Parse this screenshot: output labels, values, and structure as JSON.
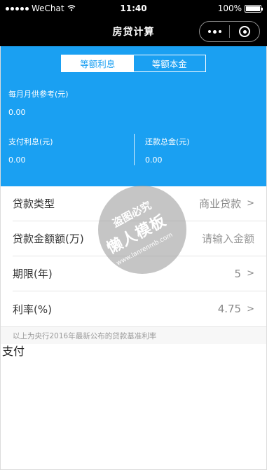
{
  "status_bar": {
    "carrier": "WeChat",
    "time": "11:40",
    "battery": "100%",
    "battery_level": 1.0
  },
  "nav": {
    "title": "房贷计算"
  },
  "tabs": [
    {
      "label": "等额利息"
    },
    {
      "label": "等额本金"
    }
  ],
  "summary": {
    "monthly_label": "每月月供参考(元)",
    "monthly_value": "0.00",
    "interest_label": "支付利息(元)",
    "interest_value": "0.00",
    "total_label": "还款总金(元)",
    "total_value": "0.00"
  },
  "form": {
    "loan_type": {
      "label": "贷款类型",
      "value": "商业贷款"
    },
    "amount": {
      "label": "贷款金额额(万)",
      "placeholder": "请输入金额"
    },
    "term": {
      "label": "期限(年)",
      "value": "5"
    },
    "rate": {
      "label": "利率(%)",
      "value": "4.75"
    },
    "chevron": ">"
  },
  "note": "以上为央行2016年最新公布的贷款基准利率",
  "pay_text": "支付",
  "watermark": {
    "line1": "盗图必究",
    "line2": "懒人模板",
    "line3": "www.lanrenmb.com"
  },
  "colors": {
    "accent": "#1aa0f2",
    "nav_bg": "#000000"
  }
}
